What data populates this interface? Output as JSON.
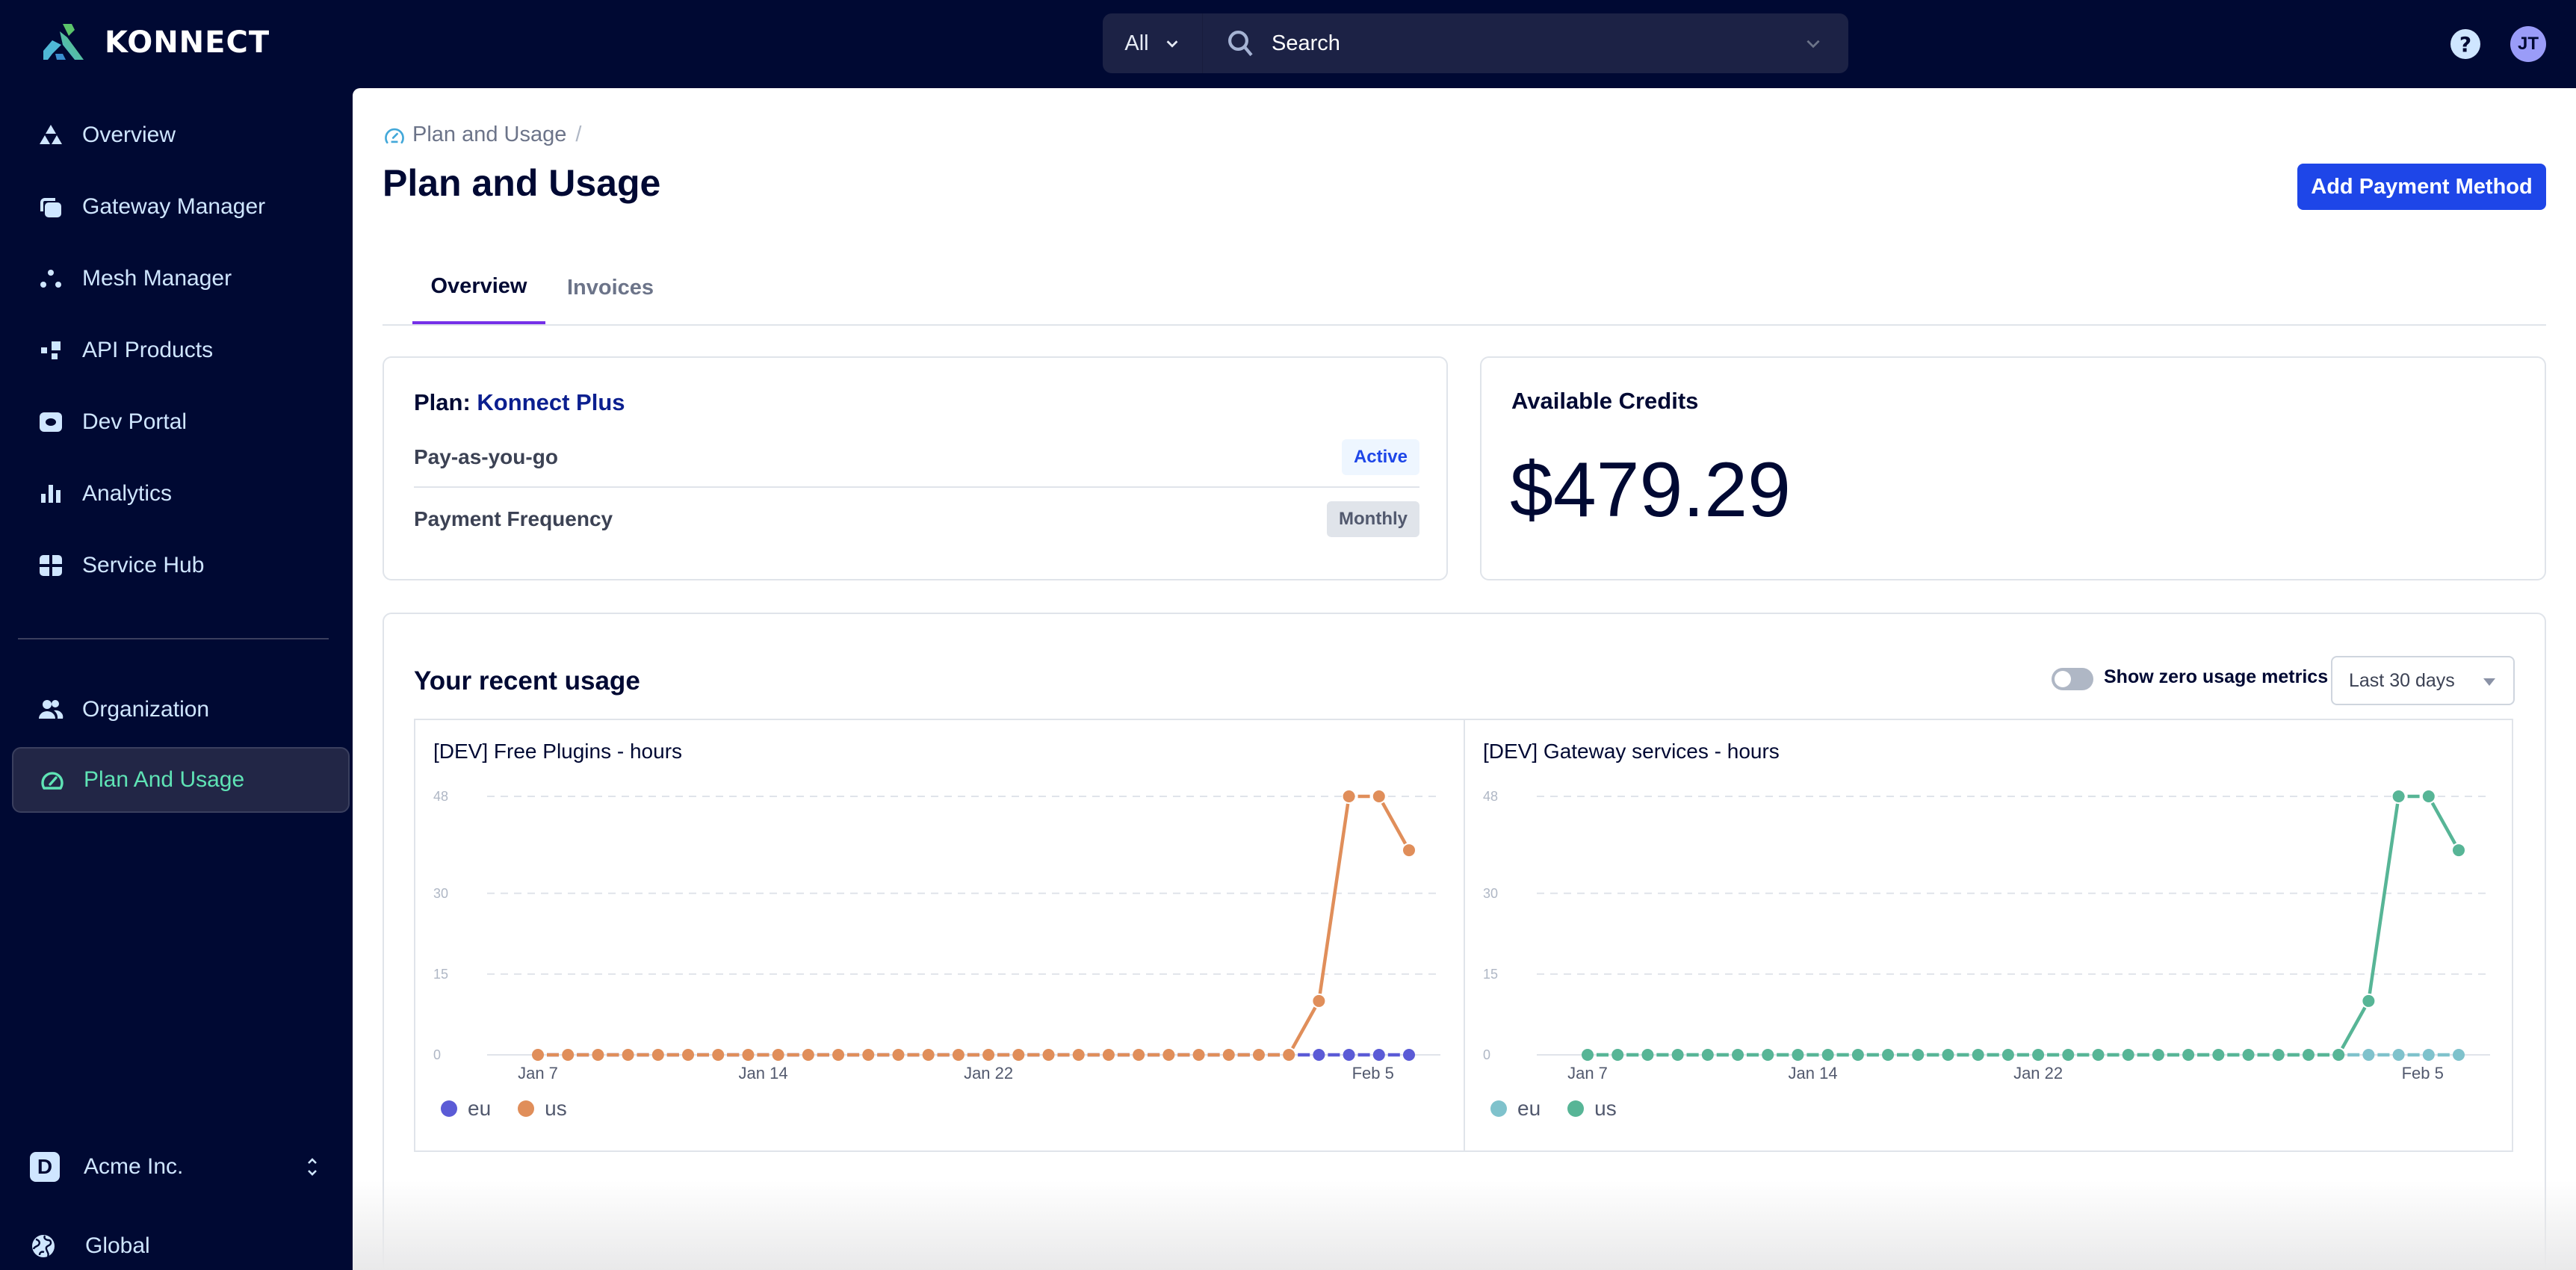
{
  "app": {
    "brand": "KONNECT"
  },
  "search": {
    "scope": "All",
    "placeholder": "Search"
  },
  "header": {
    "help_label": "?",
    "avatar_initials": "JT"
  },
  "sidebar": {
    "items": [
      {
        "label": "Overview",
        "icon": "overview-icon"
      },
      {
        "label": "Gateway Manager",
        "icon": "gateway-manager-icon"
      },
      {
        "label": "Mesh Manager",
        "icon": "mesh-manager-icon"
      },
      {
        "label": "API Products",
        "icon": "api-products-icon"
      },
      {
        "label": "Dev Portal",
        "icon": "dev-portal-icon"
      },
      {
        "label": "Analytics",
        "icon": "analytics-icon"
      },
      {
        "label": "Service Hub",
        "icon": "service-hub-icon"
      }
    ],
    "bottom_items": [
      {
        "label": "Organization",
        "icon": "organization-icon"
      },
      {
        "label": "Plan And Usage",
        "icon": "speedometer-icon",
        "active": true
      }
    ],
    "org": {
      "badge": "D",
      "name": "Acme Inc."
    },
    "region": {
      "label": "Global"
    }
  },
  "page": {
    "breadcrumb": [
      "Plan and Usage"
    ],
    "breadcrumb_sep": "/",
    "title": "Plan and Usage",
    "primary_action": "Add Payment Method",
    "tabs": [
      {
        "label": "Overview",
        "active": true
      },
      {
        "label": "Invoices",
        "active": false
      }
    ]
  },
  "plan": {
    "prefix": "Plan:",
    "name": "Konnect Plus",
    "rows": [
      {
        "label": "Pay-as-you-go",
        "badge": "Active"
      },
      {
        "label": "Payment Frequency",
        "badge": "Monthly"
      }
    ]
  },
  "credits": {
    "title": "Available Credits",
    "value": "$479.29"
  },
  "usage": {
    "title": "Your recent usage",
    "zero_toggle_label": "Show zero usage metrics",
    "zero_toggle_on": false,
    "range": "Last 30 days"
  },
  "colors": {
    "accent_blue": "#1e46e8",
    "tab_underline": "#7530e8",
    "active_nav": "#5fe3b5",
    "eu_chart1": "#5b5bd6",
    "us_chart1": "#e08e5a",
    "eu_chart2": "#7fc2cc",
    "us_chart2": "#57b596"
  },
  "chart_data": [
    {
      "type": "line",
      "title": "[DEV] Free Plugins - hours",
      "x": [
        "Jan 7",
        "Jan 8",
        "Jan 9",
        "Jan 10",
        "Jan 11",
        "Jan 12",
        "Jan 13",
        "Jan 14",
        "Jan 15",
        "Jan 16",
        "Jan 17",
        "Jan 18",
        "Jan 19",
        "Jan 20",
        "Jan 21",
        "Jan 22",
        "Jan 23",
        "Jan 24",
        "Jan 25",
        "Jan 26",
        "Jan 27",
        "Jan 28",
        "Jan 29",
        "Jan 30",
        "Jan 31",
        "Feb 1",
        "Feb 2",
        "Feb 3",
        "Feb 4",
        "Feb 5"
      ],
      "x_tick_labels": [
        {
          "label": "Jan 7",
          "index": 0
        },
        {
          "label": "Jan 14",
          "index": 7.5
        },
        {
          "label": "Jan 22",
          "index": 15
        },
        {
          "label": "Feb 5",
          "index": 27.8
        }
      ],
      "y_ticks": [
        0,
        15,
        30,
        48
      ],
      "ylim": [
        0,
        48
      ],
      "grid": true,
      "legend_position": "bottom-left",
      "series": [
        {
          "name": "eu",
          "color": "#5b5bd6",
          "values": [
            0,
            0,
            0,
            0,
            0,
            0,
            0,
            0,
            0,
            0,
            0,
            0,
            0,
            0,
            0,
            0,
            0,
            0,
            0,
            0,
            0,
            0,
            0,
            0,
            0,
            0,
            0,
            0,
            0,
            0
          ]
        },
        {
          "name": "us",
          "color": "#e08e5a",
          "values": [
            0,
            0,
            0,
            0,
            0,
            0,
            0,
            0,
            0,
            0,
            0,
            0,
            0,
            0,
            0,
            0,
            0,
            0,
            0,
            0,
            0,
            0,
            0,
            0,
            0,
            0,
            10,
            48,
            48,
            38
          ]
        }
      ]
    },
    {
      "type": "line",
      "title": "[DEV] Gateway services - hours",
      "x": [
        "Jan 7",
        "Jan 8",
        "Jan 9",
        "Jan 10",
        "Jan 11",
        "Jan 12",
        "Jan 13",
        "Jan 14",
        "Jan 15",
        "Jan 16",
        "Jan 17",
        "Jan 18",
        "Jan 19",
        "Jan 20",
        "Jan 21",
        "Jan 22",
        "Jan 23",
        "Jan 24",
        "Jan 25",
        "Jan 26",
        "Jan 27",
        "Jan 28",
        "Jan 29",
        "Jan 30",
        "Jan 31",
        "Feb 1",
        "Feb 2",
        "Feb 3",
        "Feb 4",
        "Feb 5"
      ],
      "x_tick_labels": [
        {
          "label": "Jan 7",
          "index": 0
        },
        {
          "label": "Jan 14",
          "index": 7.5
        },
        {
          "label": "Jan 22",
          "index": 15
        },
        {
          "label": "Feb 5",
          "index": 27.8
        }
      ],
      "y_ticks": [
        0,
        15,
        30,
        48
      ],
      "ylim": [
        0,
        48
      ],
      "grid": true,
      "legend_position": "bottom-left",
      "series": [
        {
          "name": "eu",
          "color": "#7fc2cc",
          "values": [
            0,
            0,
            0,
            0,
            0,
            0,
            0,
            0,
            0,
            0,
            0,
            0,
            0,
            0,
            0,
            0,
            0,
            0,
            0,
            0,
            0,
            0,
            0,
            0,
            0,
            0,
            0,
            0,
            0,
            0
          ]
        },
        {
          "name": "us",
          "color": "#57b596",
          "values": [
            0,
            0,
            0,
            0,
            0,
            0,
            0,
            0,
            0,
            0,
            0,
            0,
            0,
            0,
            0,
            0,
            0,
            0,
            0,
            0,
            0,
            0,
            0,
            0,
            0,
            0,
            10,
            48,
            48,
            38
          ]
        }
      ]
    }
  ]
}
